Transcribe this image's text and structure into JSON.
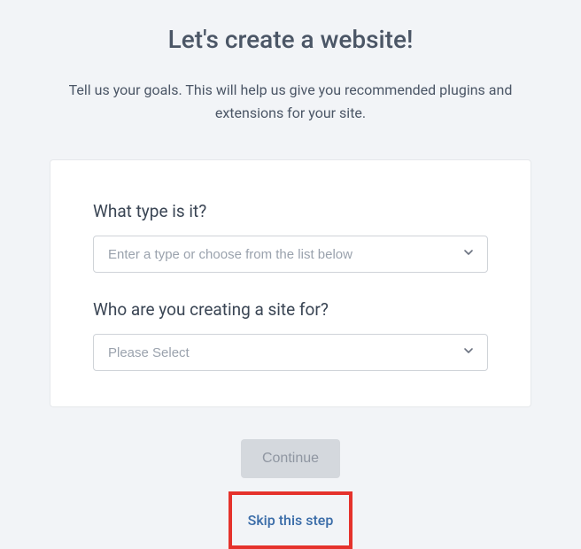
{
  "header": {
    "title": "Let's create a website!",
    "subtitle": "Tell us your goals. This will help us give you recommended plugins and extensions for your site."
  },
  "form": {
    "fields": [
      {
        "label": "What type is it?",
        "placeholder": "Enter a type or choose from the list below"
      },
      {
        "label": "Who are you creating a site for?",
        "placeholder": "Please Select"
      }
    ]
  },
  "actions": {
    "continue_label": "Continue",
    "skip_label": "Skip this step"
  }
}
